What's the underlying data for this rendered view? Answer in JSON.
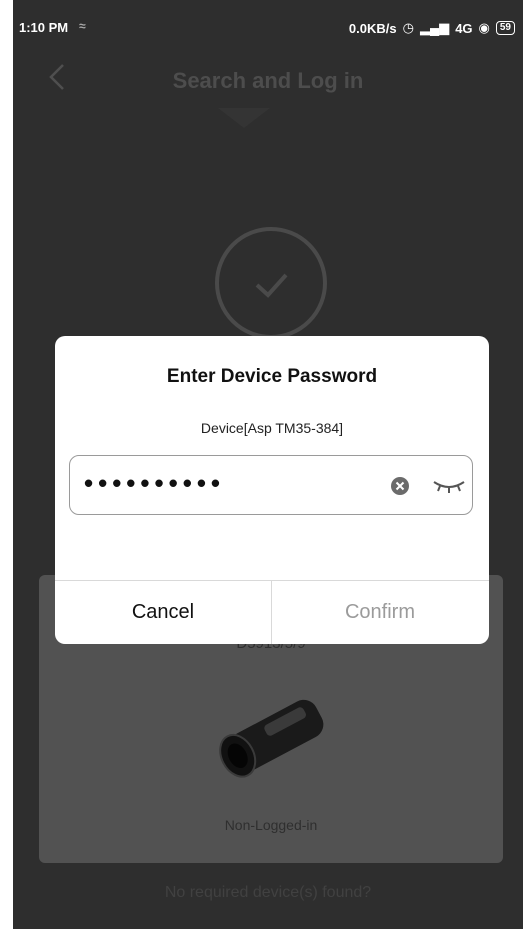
{
  "status_bar": {
    "time": "1:10 PM",
    "network_speed": "0.0KB/s",
    "signal": "4G",
    "battery": "59"
  },
  "header": {
    "title": "Search and Log in"
  },
  "device_card": {
    "serial": "D5913/5/9",
    "status": "Non-Logged-in"
  },
  "footer": {
    "not_found_link": "No required device(s) found?"
  },
  "dialog": {
    "title": "Enter Device Password",
    "device_label": "Device[Asp TM35-384]",
    "password_masked": "••••••••••",
    "cancel_label": "Cancel",
    "confirm_label": "Confirm"
  },
  "colors": {
    "overlay_background": "#2e2e2e",
    "dialog_background": "#ffffff",
    "confirm_disabled": "#9b9b9b"
  }
}
